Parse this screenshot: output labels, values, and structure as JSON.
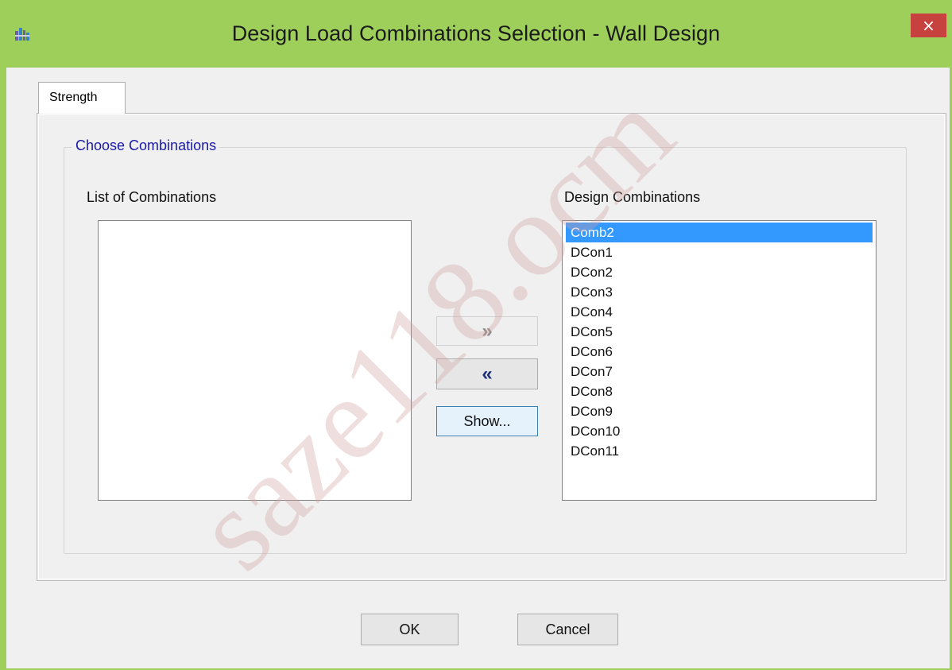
{
  "window": {
    "title": "Design Load Combinations Selection - Wall Design",
    "close_label": "×",
    "accent_color": "#9ecf5a",
    "close_color": "#c7413f"
  },
  "tabs": [
    {
      "label": "Strength",
      "selected": true
    }
  ],
  "group": {
    "legend": "Choose Combinations"
  },
  "available": {
    "label": "List of Combinations",
    "items": []
  },
  "design": {
    "label": "Design Combinations",
    "selected_index": 0,
    "items": [
      "Comb2",
      "DCon1",
      "DCon2",
      "DCon3",
      "DCon4",
      "DCon5",
      "DCon6",
      "DCon7",
      "DCon8",
      "DCon9",
      "DCon10",
      "DCon11"
    ]
  },
  "transfer": {
    "add_label": "»",
    "add_enabled": false,
    "remove_label": "«",
    "show_label": "Show..."
  },
  "footer": {
    "ok_label": "OK",
    "cancel_label": "Cancel"
  },
  "watermark": "saze118.ocm",
  "icons": [
    "app-icon",
    "close-icon"
  ]
}
